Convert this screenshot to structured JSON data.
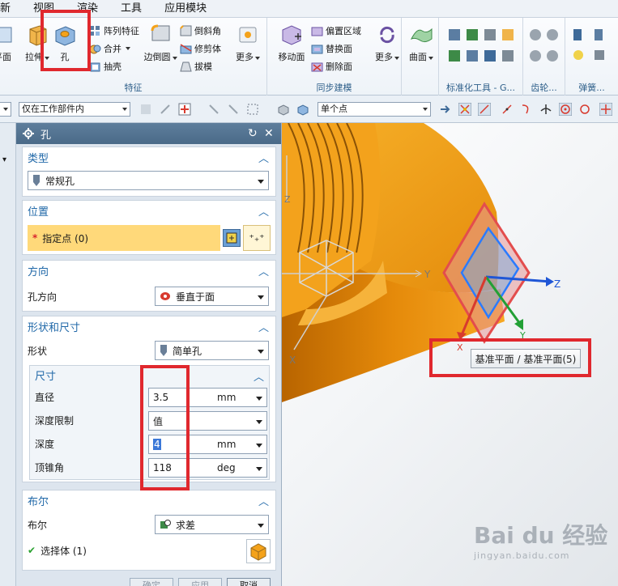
{
  "menu": [
    "新",
    "视图",
    "渲染",
    "工具",
    "应用模块"
  ],
  "ribbon": {
    "features_group_label": "特征",
    "sync_group_label": "同步建模",
    "std_group_label": "标准化工具 - G...",
    "gear_group_label": "齿轮...",
    "spring_group_label": "弹簧...",
    "left_partial_label": "平面",
    "extrude_label": "拉伸",
    "hole_label": "孔",
    "pattern_feature_label": "阵列特征",
    "combine_label": "合并",
    "shell_label": "抽壳",
    "edge_blend_label": "边倒圆",
    "chamfer_label": "倒斜角",
    "trim_body_label": "修剪体",
    "draft_label": "拔模",
    "more_label": "更多",
    "move_face_label": "移动面",
    "offset_region_label": "偏置区域",
    "replace_face_label": "替换面",
    "delete_face_label": "删除面",
    "surface_label": "曲面"
  },
  "selbar": {
    "scope_filter": "仅在工作部件内",
    "point_filter": "单个点"
  },
  "dialog": {
    "title": "孔",
    "type": {
      "header": "类型",
      "value": "常规孔"
    },
    "position": {
      "header": "位置",
      "label": "指定点 (0)",
      "required_mark": "*"
    },
    "direction": {
      "header": "方向",
      "label": "孔方向",
      "value": "垂直于面"
    },
    "form": {
      "header": "形状和尺寸",
      "shape_label": "形状",
      "shape_value": "简单孔",
      "dims_header": "尺寸",
      "diameter_label": "直径",
      "diameter_value": "3.5",
      "diameter_unit": "mm",
      "depth_limit_label": "深度限制",
      "depth_limit_value": "值",
      "depth_label": "深度",
      "depth_value": "4",
      "depth_unit": "mm",
      "tip_angle_label": "顶锥角",
      "tip_angle_value": "118",
      "tip_angle_unit": "deg"
    },
    "boolean": {
      "header": "布尔",
      "label": "布尔",
      "value": "求差",
      "select_body_label": "选择体 (1)"
    },
    "buttons": {
      "ok": "确定",
      "apply": "应用",
      "cancel": "取消"
    }
  },
  "viewport": {
    "tooltip": "基准平面 / 基准平面(5)",
    "axis_x": "X",
    "axis_y": "Y",
    "axis_z": "Z",
    "watermark_main": "Bai du 经验",
    "watermark_sub": "jingyan.baidu.com"
  },
  "colors": {
    "highlight_red": "#e0282e",
    "part_orange": "#f4a21a",
    "section_header_blue": "#2068a8",
    "point_field_yellow": "#ffd97a",
    "axis_blue": "#1f56d6",
    "axis_green": "#22a035",
    "axis_red": "#d83a2e"
  }
}
